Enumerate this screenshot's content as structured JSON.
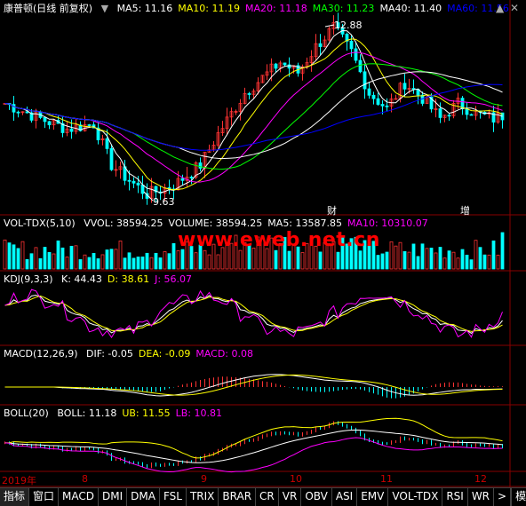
{
  "header": {
    "title": "康普顿(日线 前复权)",
    "ma": [
      {
        "label": "MA5: 11.16",
        "color": "#ffffff"
      },
      {
        "label": "MA10: 11.19",
        "color": "#ffff00"
      },
      {
        "label": "MA20: 11.18",
        "color": "#ff00ff"
      },
      {
        "label": "MA30: 11.23",
        "color": "#00ff00"
      },
      {
        "label": "MA40: 11.40",
        "color": "#ffffff"
      },
      {
        "label": "MA60: 11.56",
        "color": "#0000ff"
      }
    ],
    "nav_down": "▼",
    "nav_up": "▲",
    "close": "✕"
  },
  "price_chart": {
    "high_label": "12.88",
    "low_label": "9.63",
    "markers": [
      "财",
      "增"
    ]
  },
  "volume": {
    "title": "VOL-TDX(5,10)",
    "items": [
      {
        "label": "VVOL: 38594.25",
        "color": "#ffffff"
      },
      {
        "label": "VOLUME: 38594.25",
        "color": "#ffffff"
      },
      {
        "label": "MA5: 13587.85",
        "color": "#ffffff"
      },
      {
        "label": "MA10: 10310.07",
        "color": "#ff00ff"
      }
    ],
    "watermark": "www.eweb.net.cn"
  },
  "kdj": {
    "title": "KDJ(9,3,3)",
    "items": [
      {
        "label": "K: 44.43",
        "color": "#ffffff"
      },
      {
        "label": "D: 38.61",
        "color": "#ffff00"
      },
      {
        "label": "J: 56.07",
        "color": "#ff00ff"
      }
    ]
  },
  "macd": {
    "title": "MACD(12,26,9)",
    "items": [
      {
        "label": "DIF: -0.05",
        "color": "#ffffff"
      },
      {
        "label": "DEA: -0.09",
        "color": "#ffff00"
      },
      {
        "label": "MACD: 0.08",
        "color": "#ff00ff"
      }
    ]
  },
  "boll": {
    "title": "BOLL(20)",
    "items": [
      {
        "label": "BOLL: 11.18",
        "color": "#ffffff"
      },
      {
        "label": "UB: 11.55",
        "color": "#ffff00"
      },
      {
        "label": "LB: 10.81",
        "color": "#ff00ff"
      }
    ]
  },
  "dates": [
    "2019年",
    "8",
    "9",
    "10",
    "11",
    "12"
  ],
  "tabs": [
    "指标",
    "窗口",
    "MACD",
    "DMI",
    "DMA",
    "FSL",
    "TRIX",
    "BRAR",
    "CR",
    "VR",
    "OBV",
    "ASI",
    "EMV",
    "VOL-TDX",
    "RSI",
    "WR",
    ">"
  ],
  "tab_right": "模板",
  "colors": {
    "up": "#ff3333",
    "down": "#00ffff",
    "bg": "#000000",
    "grid": "#880000"
  },
  "chart_data": {
    "type": "line",
    "title": "康普顿(日线 前复权)",
    "price_high": 12.88,
    "price_low": 9.63,
    "series": [
      {
        "name": "MA5",
        "value": 11.16
      },
      {
        "name": "MA10",
        "value": 11.19
      },
      {
        "name": "MA20",
        "value": 11.18
      },
      {
        "name": "MA30",
        "value": 11.23
      },
      {
        "name": "MA40",
        "value": 11.4
      },
      {
        "name": "MA60",
        "value": 11.56
      }
    ],
    "indicators": {
      "VVOL": 38594.25,
      "VOLUME": 38594.25,
      "VOL_MA5": 13587.85,
      "VOL_MA10": 10310.07,
      "K": 44.43,
      "D": 38.61,
      "J": 56.07,
      "DIF": -0.05,
      "DEA": -0.09,
      "MACD": 0.08,
      "BOLL": 11.18,
      "UB": 11.55,
      "LB": 10.81
    }
  }
}
